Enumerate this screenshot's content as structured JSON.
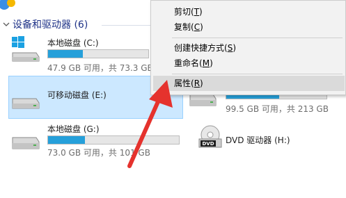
{
  "section": {
    "title": "设备和驱动器 (6)"
  },
  "drives": [
    {
      "name": "本地磁盘 (C:)",
      "info": "47.9 GB 可用，共 73.3 GB",
      "used_fraction": 0.35
    },
    {
      "name": "可移动磁盘 (E:)",
      "info": ""
    },
    {
      "name": "",
      "info": "99.5 GB 可用，共 213 GB",
      "used_fraction": 0.53
    },
    {
      "name": "本地磁盘 (G:)",
      "info": "73.0 GB 可用，共 101 GB",
      "used_fraction": 0.28
    },
    {
      "name": "DVD 驱动器 (H:)",
      "info": "",
      "badge": "DVD"
    }
  ],
  "context_menu": {
    "items": [
      {
        "label": "剪切",
        "key": "T"
      },
      {
        "label": "复制",
        "key": "C"
      },
      {
        "label": "创建快捷方式",
        "key": "S"
      },
      {
        "label": "重命名",
        "key": "M"
      },
      {
        "label": "属性",
        "key": "R"
      }
    ]
  },
  "colors": {
    "accent": "#26a0da",
    "selection": "#cce8ff",
    "arrow": "#e5322d",
    "menu_bg": "#f2f2f2"
  },
  "icons": [
    "chevron-down-icon",
    "windows-drive-icon",
    "removable-drive-icon",
    "hard-drive-icon",
    "dvd-drive-icon",
    "annotation-arrow"
  ]
}
